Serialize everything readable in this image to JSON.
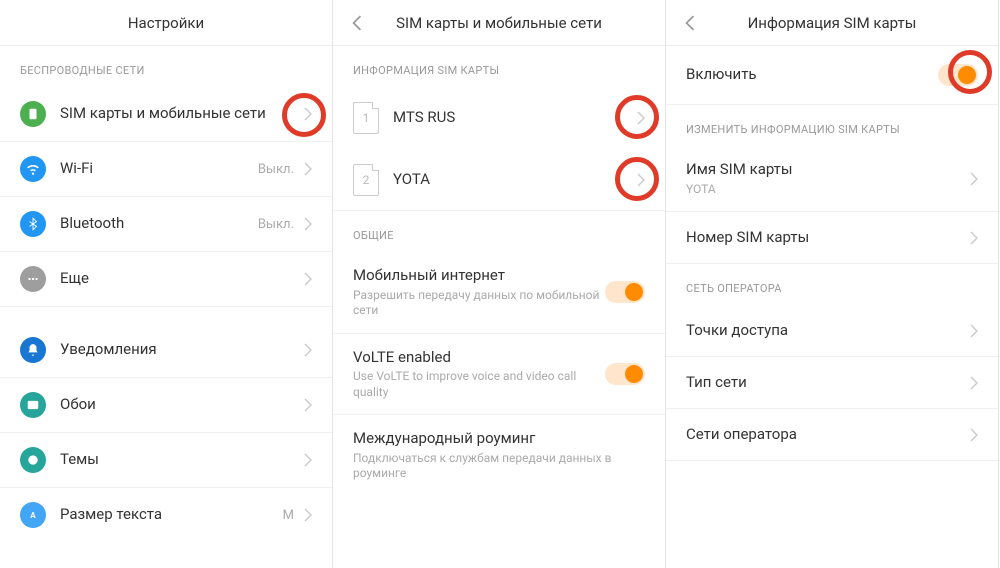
{
  "pane1": {
    "title": "Настройки",
    "section1": "БЕСПРОВОДНЫЕ СЕТИ",
    "items": {
      "sim": "SIM карты и мобильные сети",
      "wifi": "Wi-Fi",
      "wifi_val": "Выкл.",
      "bt": "Bluetooth",
      "bt_val": "Выкл.",
      "more": "Еще",
      "notif": "Уведомления",
      "wallpaper": "Обои",
      "themes": "Темы",
      "textsize": "Размер текста",
      "textsize_val": "М"
    }
  },
  "pane2": {
    "title": "SIM карты и мобильные сети",
    "section1": "ИНФОРМАЦИЯ SIM КАРТЫ",
    "sim1_num": "1",
    "sim1": "MTS RUS",
    "sim2_num": "2",
    "sim2": "YOTA",
    "section2": "ОБЩИЕ",
    "mobile_data": "Мобильный интернет",
    "mobile_data_sub": "Разрешить передачу данных по мобильной сети",
    "volte": "VoLTE enabled",
    "volte_sub": "Use VoLTE to improve voice and video call quality",
    "roaming": "Международный роуминг",
    "roaming_sub": "Подключаться к службам передачи данных в роуминге"
  },
  "pane3": {
    "title": "Информация SIM карты",
    "enable": "Включить",
    "section1": "ИЗМЕНИТЬ ИНФОРМАЦИЮ SIM КАРТЫ",
    "sim_name": "Имя SIM карты",
    "sim_name_val": "YOTA",
    "sim_number": "Номер SIM карты",
    "section2": "СЕТЬ ОПЕРАТОРА",
    "apn": "Точки доступа",
    "net_type": "Тип сети",
    "carrier_net": "Сети оператора"
  }
}
